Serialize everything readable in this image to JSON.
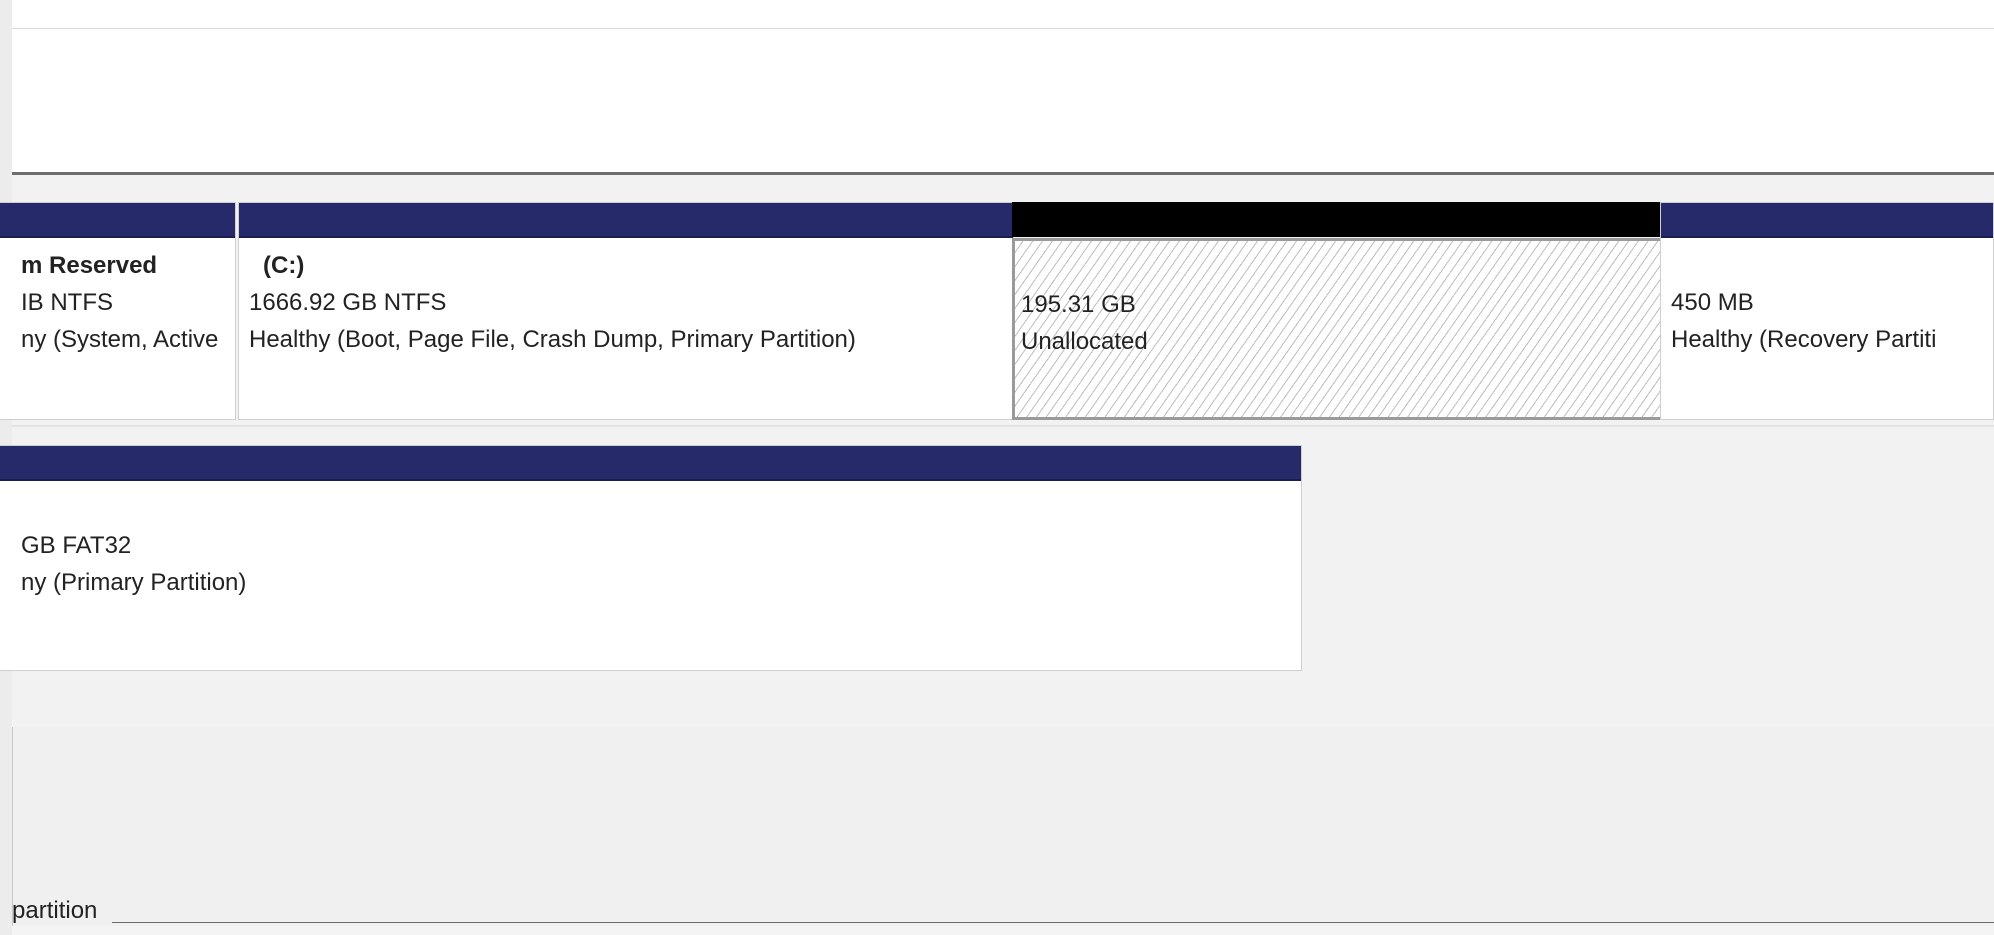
{
  "disk_row_1": {
    "partitions": [
      {
        "title": "m Reserved",
        "size": "IB NTFS",
        "status": "ny (System, Active"
      },
      {
        "title": "(C:)",
        "size": "1666.92 GB NTFS",
        "status": "Healthy (Boot, Page File, Crash Dump, Primary Partition)"
      },
      {
        "size": "195.31 GB",
        "status": "Unallocated"
      },
      {
        "size": "450 MB",
        "status": "Healthy (Recovery Partiti"
      }
    ]
  },
  "disk_row_2": {
    "partitions": [
      {
        "size": "GB FAT32",
        "status": "ny (Primary Partition)"
      }
    ]
  },
  "legend": {
    "text": "partition"
  },
  "colors": {
    "primary_partition_bar": "#262a6b",
    "unallocated_bar": "#000000",
    "splitter": "#6e6e6e"
  }
}
